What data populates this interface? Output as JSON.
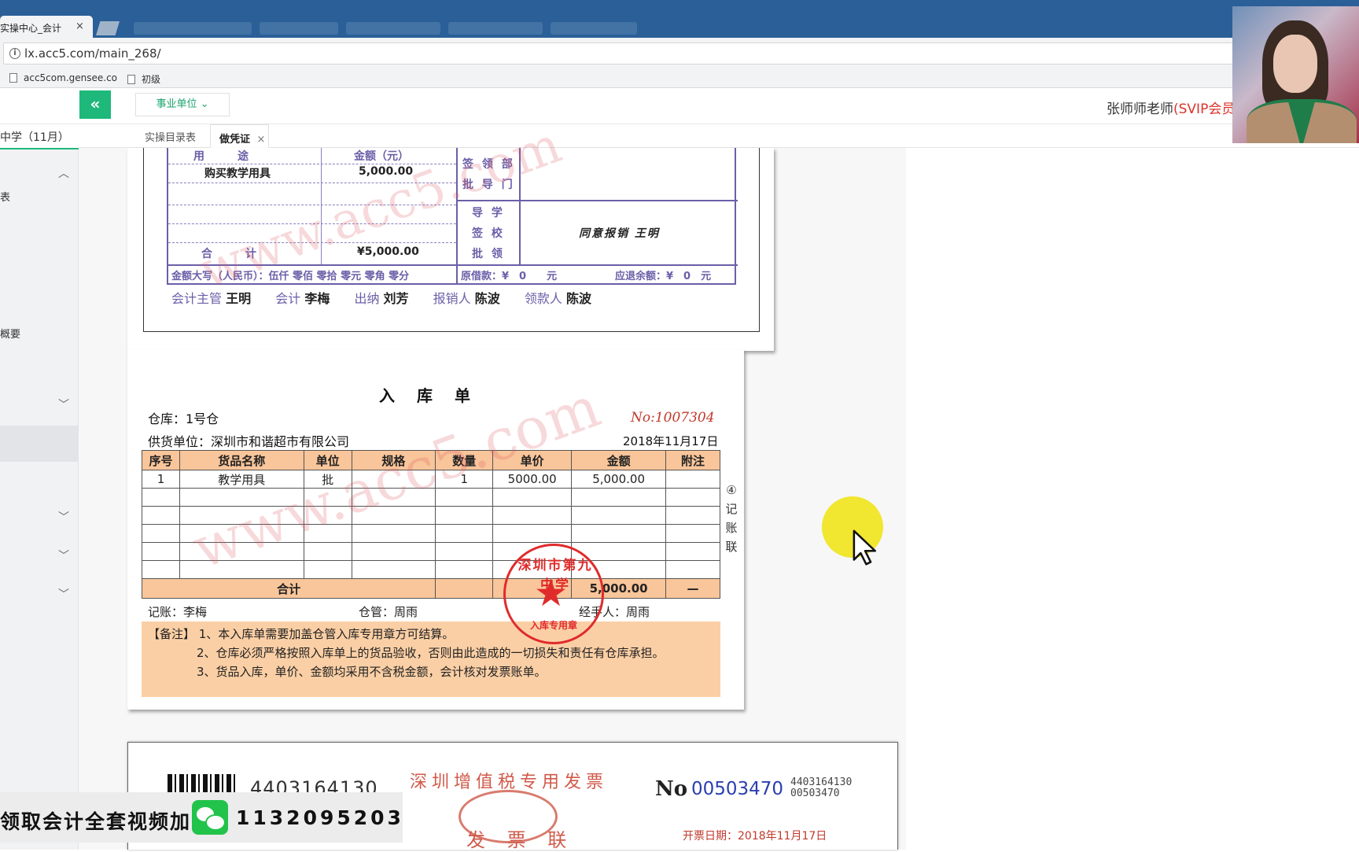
{
  "browser": {
    "tab_title": "实操中心_会计",
    "tab_close": "×",
    "url": "lx.acc5.com/main_268/",
    "bookmarks": [
      "acc5com.gensee.co",
      "初级"
    ]
  },
  "header": {
    "unit_select": "事业单位 ⌄",
    "collapse_icon": "«",
    "user": "张师师老师",
    "user_badge": "(SVIP会员)"
  },
  "tabs": {
    "items": [
      "实操目录表",
      "做凭证"
    ],
    "close": "×"
  },
  "sidebar": {
    "items": [
      "中学（11月）",
      "表",
      "概要"
    ]
  },
  "voucher": {
    "col_purpose": "用　　　途",
    "col_amount": "金额（元）",
    "row1_purpose": "购买教学用具",
    "row1_amount": "5,000.00",
    "total_label": "合　　　计",
    "total_amount": "¥5,000.00",
    "dept_label_1": "签 领 部",
    "dept_label_2": "批 导 门",
    "school_label_1": "导 学",
    "school_label_2": "签 校",
    "school_label_3": "批 领",
    "approval": "同意报销  王明",
    "amount_words": "金额大写（人民币）：伍仟 零佰 零拾 零元 零角 零分",
    "loan": "原借款：¥　0　　元",
    "refund": "应退余额：¥　0　元",
    "signatures": [
      {
        "label": "会计主管",
        "value": "王明"
      },
      {
        "label": "会计",
        "value": "李梅"
      },
      {
        "label": "出纳",
        "value": "刘芳"
      },
      {
        "label": "报销人",
        "value": "陈波"
      },
      {
        "label": "领款人",
        "value": "陈波"
      }
    ]
  },
  "receipt": {
    "title": "入库单",
    "warehouse": "仓库：1号仓",
    "number": "No:1007304",
    "supplier": "供货单位：深圳市和谐超市有限公司",
    "date": "2018年11月17日",
    "headers": [
      "序号",
      "货品名称",
      "单位",
      "规格",
      "数量",
      "单价",
      "金额",
      "附注"
    ],
    "rows": [
      [
        "1",
        "教学用具",
        "批",
        "",
        "1",
        "5000.00",
        "5,000.00",
        ""
      ]
    ],
    "total_label": "合计",
    "total_amount": "5,000.00",
    "total_note": "—",
    "side_label": "④记账联",
    "bookkeeper": "记账：李梅",
    "keeper": "仓管：周雨",
    "handler": "经手人：周雨",
    "notes": [
      "【备注】 1、本入库单需要加盖仓管入库专用章方可结算。",
      "2、仓库必须严格按照入库单上的货品验收，否则由此造成的一切损失和责任有仓库承担。",
      "3、货品入库，单价、金额均采用不含税金额，会计核对发票账单。"
    ],
    "stamp_top": "深圳市第九中学",
    "stamp_bottom": "入库专用章"
  },
  "invoice": {
    "code": "4403164130",
    "title": "深圳增值税专用发票",
    "type": "发 票 联",
    "no_label": "No",
    "number": "00503470",
    "small_code": "4403164130",
    "small_number": "00503470",
    "date": "开票日期：2018年11月17日"
  },
  "watermark": "www.acc5.com",
  "promo": {
    "text": "领取会计全套视频加",
    "number": "1132095203"
  },
  "colors": {
    "accent_green": "#1db87a",
    "voucher_purple": "#6b5fa8",
    "table_orange": "#f9c59a",
    "stamp_red": "#e02b2b"
  }
}
